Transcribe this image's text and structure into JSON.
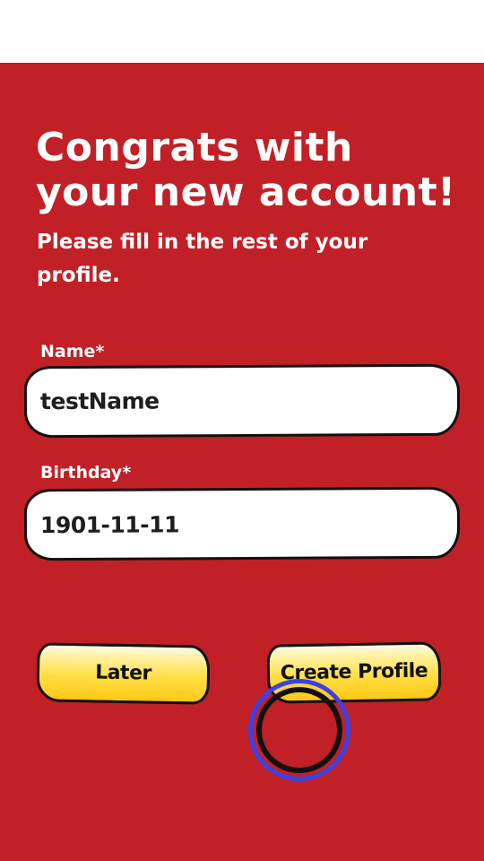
{
  "header": {
    "title": "Congrats with your new account!",
    "subtitle": "Please fill in the rest of your profile."
  },
  "form": {
    "name_label": "Name*",
    "name_value": "testName",
    "birthday_label": "Birthday*",
    "birthday_value": "1901-11-11"
  },
  "actions": {
    "later_label": "Later",
    "create_label": "Create Profile"
  },
  "colors": {
    "background": "#c12026",
    "button_fill": "#ffd633",
    "touch_ring": "#3a42e6"
  }
}
